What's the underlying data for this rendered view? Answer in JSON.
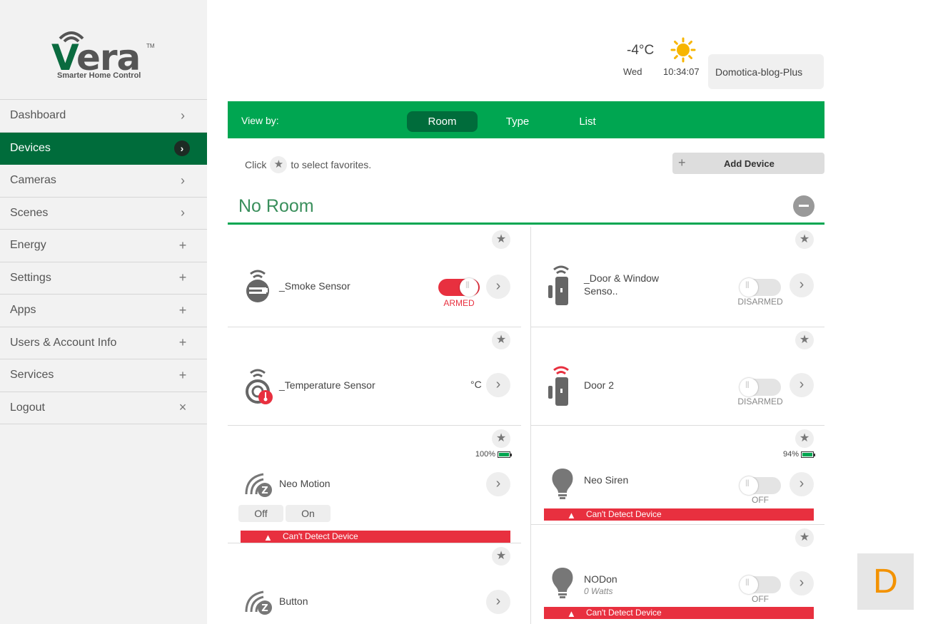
{
  "brand": {
    "name": "Vera",
    "tm": "TM",
    "tagline": "Smarter Home Control"
  },
  "sidebar": {
    "items": [
      {
        "label": "Dashboard",
        "glyph": "›"
      },
      {
        "label": "Devices",
        "glyph": "›"
      },
      {
        "label": "Cameras",
        "glyph": "›"
      },
      {
        "label": "Scenes",
        "glyph": "›"
      },
      {
        "label": "Energy",
        "glyph": "+"
      },
      {
        "label": "Settings",
        "glyph": "+"
      },
      {
        "label": "Apps",
        "glyph": "+"
      },
      {
        "label": "Users & Account Info",
        "glyph": "+"
      },
      {
        "label": "Services",
        "glyph": "+"
      },
      {
        "label": "Logout",
        "glyph": "×"
      }
    ],
    "active": "Devices"
  },
  "header": {
    "temperature": "-4°C",
    "day": "Wed",
    "time": "10:34:07",
    "account": "Domotica-blog-Plus",
    "weather_icon": "sun-icon"
  },
  "viewbar": {
    "label": "View by:",
    "tabs": [
      "Room",
      "Type",
      "List"
    ],
    "selected": "Room"
  },
  "toolbar": {
    "fav_hint_before": "Click",
    "fav_hint_after": "to select favorites.",
    "add_device": "Add Device"
  },
  "room": {
    "title": "No Room"
  },
  "devices": {
    "smoke": {
      "name": "_Smoke Sensor",
      "state": "ARMED",
      "icon": "smoke-sensor-icon"
    },
    "door_window": {
      "name_line1": "_Door & Window",
      "name_line2": "Senso..",
      "state": "DISARMED",
      "icon": "door-sensor-icon"
    },
    "temperature": {
      "name": "_Temperature Sensor",
      "unit": "°C",
      "icon": "temperature-sensor-icon"
    },
    "door2": {
      "name": "Door 2",
      "state": "DISARMED",
      "icon": "door-sensor-icon"
    },
    "neo_motion": {
      "name": "Neo Motion",
      "battery": "100%",
      "off_label": "Off",
      "on_label": "On",
      "alert": "Can't Detect Device",
      "icon": "zwave-motion-icon"
    },
    "neo_siren": {
      "name": "Neo Siren",
      "battery": "94%",
      "state": "OFF",
      "alert": "Can't Detect Device",
      "icon": "bulb-icon"
    },
    "button": {
      "name": "Button",
      "icon": "zwave-button-icon"
    },
    "nodon": {
      "name": "NODon",
      "sub": "0 Watts",
      "state": "OFF",
      "alert": "Can't Detect Device",
      "icon": "bulb-icon"
    }
  },
  "corner_tile": {
    "letter": "D"
  },
  "colors": {
    "green": "#00a651",
    "dark_green": "#006c3b",
    "red": "#e8303f",
    "orange": "#f39200"
  }
}
